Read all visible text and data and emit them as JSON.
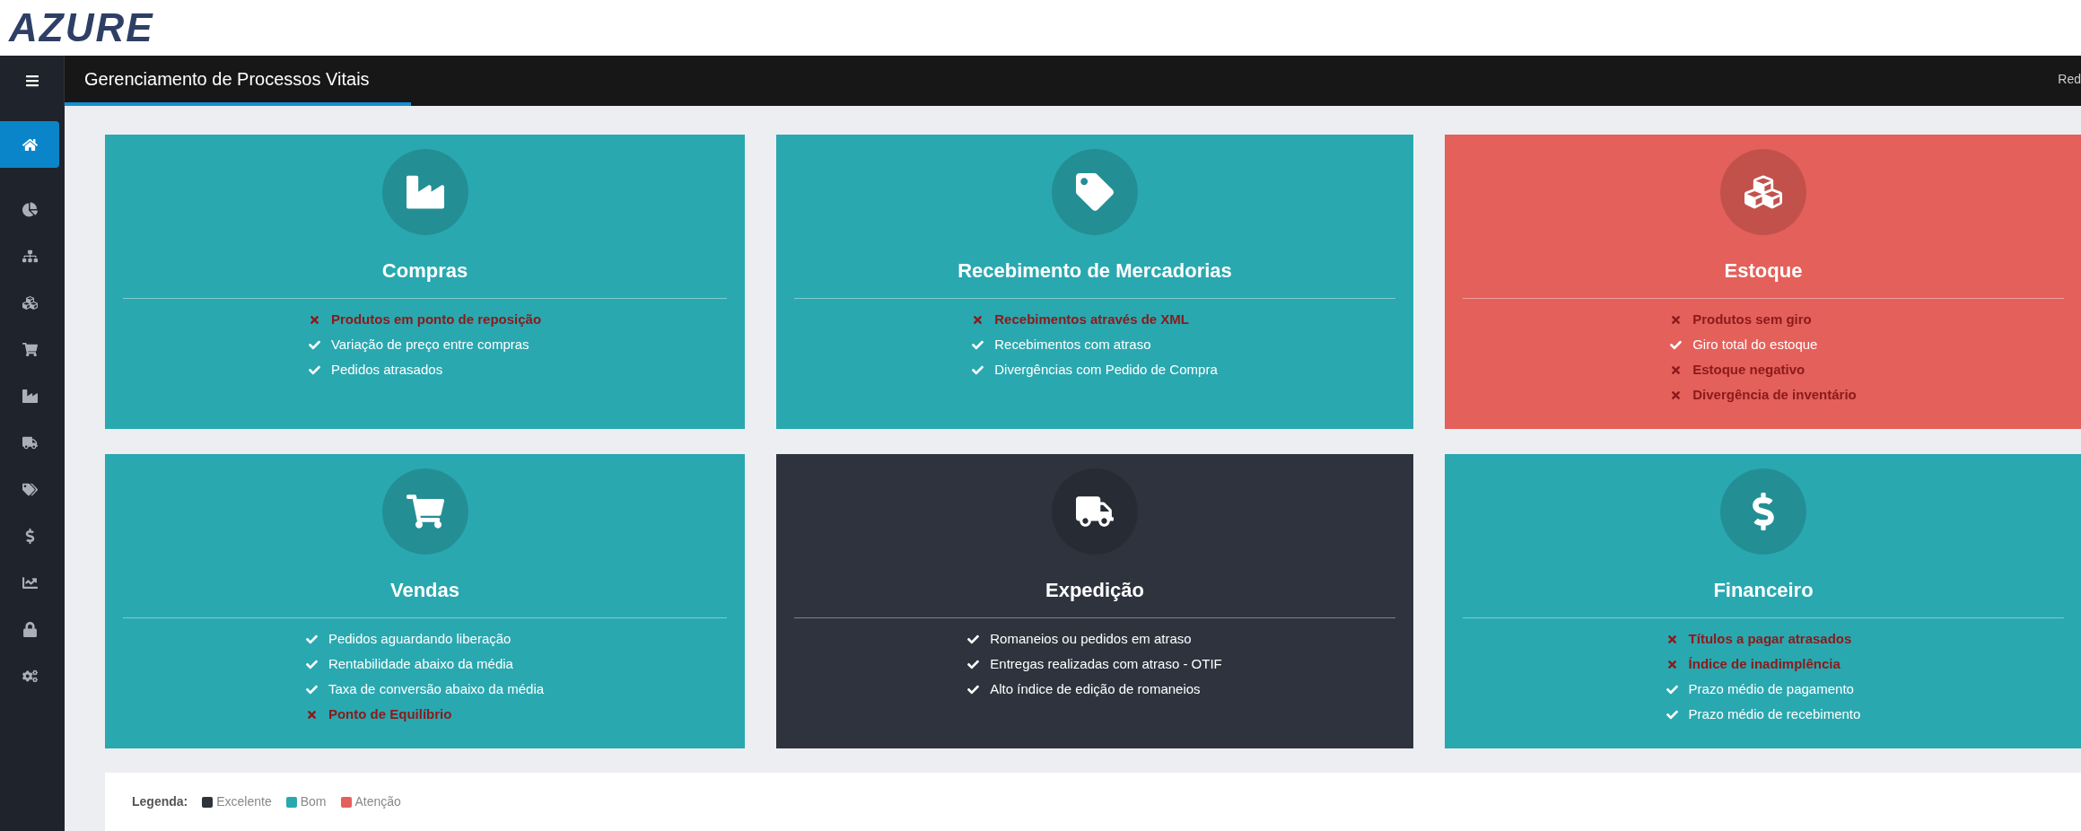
{
  "logo": "AZURE",
  "topbar": {
    "title": "Gerenciamento de Processos Vitais",
    "right_text": "Red"
  },
  "sidebar": {
    "items": [
      {
        "selected": true
      },
      {
        "selected": false
      },
      {
        "selected": false
      },
      {
        "selected": false
      },
      {
        "selected": false
      },
      {
        "selected": false
      },
      {
        "selected": false
      },
      {
        "selected": false
      },
      {
        "selected": false
      },
      {
        "selected": false
      },
      {
        "selected": false
      },
      {
        "selected": false
      }
    ]
  },
  "cards": [
    {
      "title": "Compras",
      "color": "#2aa8b0",
      "items": [
        {
          "text": "Produtos em ponto de reposição",
          "ok": false
        },
        {
          "text": "Variação de preço entre compras",
          "ok": true
        },
        {
          "text": "Pedidos atrasados",
          "ok": true
        }
      ]
    },
    {
      "title": "Recebimento de Mercadorias",
      "color": "#2aa8b0",
      "items": [
        {
          "text": "Recebimentos através de XML",
          "ok": false
        },
        {
          "text": "Recebimentos com atraso",
          "ok": true
        },
        {
          "text": "Divergências com Pedido de Compra",
          "ok": true
        }
      ]
    },
    {
      "title": "Estoque",
      "color": "#e4605a",
      "items": [
        {
          "text": "Produtos sem giro",
          "ok": false
        },
        {
          "text": "Giro total do estoque",
          "ok": true
        },
        {
          "text": "Estoque negativo",
          "ok": false
        },
        {
          "text": "Divergência de inventário",
          "ok": false
        }
      ]
    },
    {
      "title": "Vendas",
      "color": "#2aa8b0",
      "items": [
        {
          "text": "Pedidos aguardando liberação",
          "ok": true
        },
        {
          "text": "Rentabilidade abaixo da média",
          "ok": true
        },
        {
          "text": "Taxa de conversão abaixo da média",
          "ok": true
        },
        {
          "text": "Ponto de Equilíbrio",
          "ok": false
        }
      ]
    },
    {
      "title": "Expedição",
      "color": "#2e333d",
      "items": [
        {
          "text": "Romaneios ou pedidos em atraso",
          "ok": true
        },
        {
          "text": "Entregas realizadas com atraso - OTIF",
          "ok": true
        },
        {
          "text": "Alto índice de edição de romaneios",
          "ok": true
        }
      ]
    },
    {
      "title": "Financeiro",
      "color": "#2aa8b0",
      "items": [
        {
          "text": "Títulos a pagar atrasados",
          "ok": false
        },
        {
          "text": "Índice de inadimplência",
          "ok": false
        },
        {
          "text": "Prazo médio de pagamento",
          "ok": true
        },
        {
          "text": "Prazo médio de recebimento",
          "ok": true
        }
      ]
    }
  ],
  "legend": {
    "label": "Legenda:",
    "entries": [
      {
        "text": "Excelente",
        "color": "#2e333d"
      },
      {
        "text": "Bom",
        "color": "#2aa8b0"
      },
      {
        "text": "Atenção",
        "color": "#e4605a"
      }
    ]
  }
}
